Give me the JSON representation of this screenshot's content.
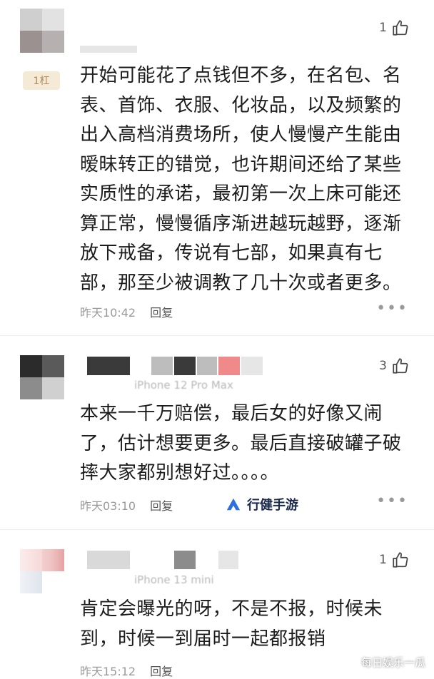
{
  "comments": [
    {
      "likes": "1",
      "badge": "1杠",
      "text": "开始可能花了点钱但不多，在名包、名表、首饰、衣服、化妆品，以及频繁的出入高档消费场所，使人慢慢产生能由暧昧转正的错觉，也许期间还给了某些实质性的承诺，最初第一次上床可能还算正常，慢慢循序渐进越玩越野，逐渐放下戒备，传说有七部，如果真有七部，那至少被调教了几十次或者更多。",
      "time": "昨天10:42",
      "reply": "回复",
      "more": "•••"
    },
    {
      "likes": "3",
      "device": "iPhone 12 Pro Max",
      "text": "本来一千万赔偿，最后女的好像又闹了，估计想要更多。最后直接破罐子破摔大家都别想好过。。。。",
      "time": "昨天03:10",
      "reply": "回复",
      "more": "•••"
    },
    {
      "likes": "1",
      "device": "iPhone 13 mini",
      "text": "肯定会曝光的呀，不是不报，时候未到，时候一到届时一起都报销",
      "time": "昨天15:12",
      "reply": "回复",
      "more": "•••"
    }
  ],
  "watermark": {
    "text": "行健手游"
  },
  "brand": {
    "text": "每日娱乐一瓜"
  },
  "colors": {
    "text": "#1c1c1c",
    "meta": "#9a9a9a",
    "badge_bg": "#f5ead6",
    "badge_fg": "#b08957"
  }
}
